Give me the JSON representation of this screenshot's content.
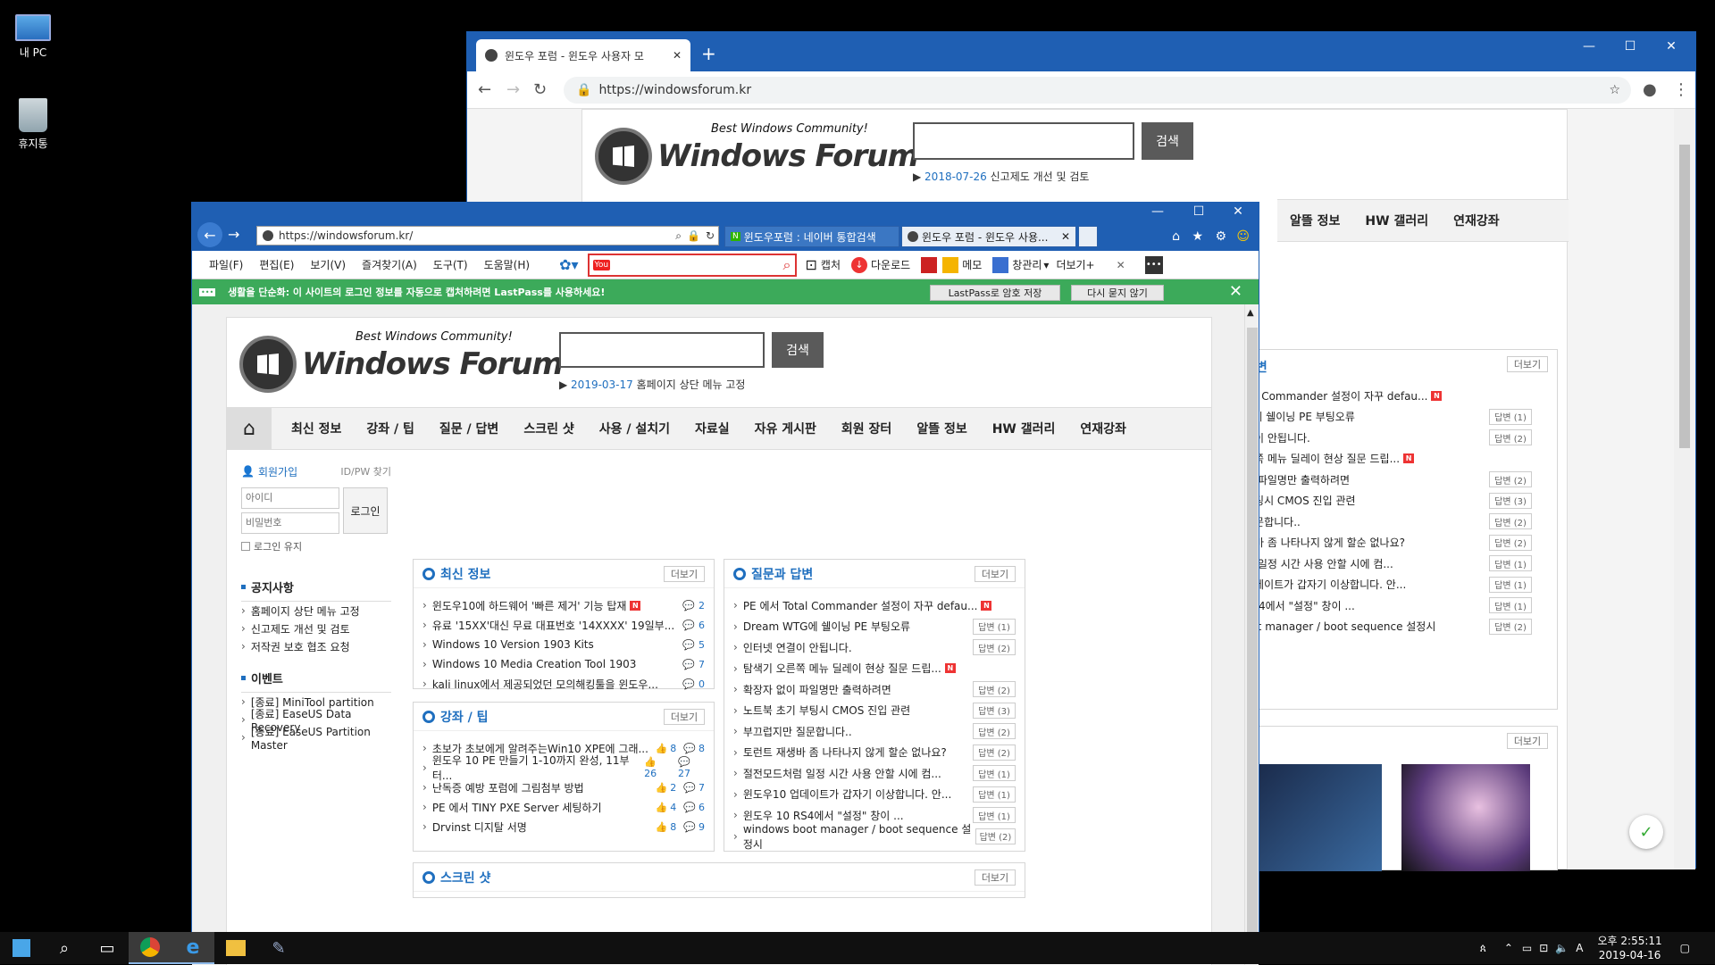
{
  "desktop": {
    "icons": [
      {
        "label": "내 PC"
      },
      {
        "label": "휴지통"
      }
    ]
  },
  "chrome": {
    "tab_title": "윈도우 포럼 - 윈도우 사용자 모",
    "url": "https://windowsforum.kr",
    "site": {
      "tagline": "Best Windows Community!",
      "logo_text": "Windows Forum",
      "search_button": "검색",
      "notice_date": "2018-07-26",
      "notice_text": "신고제도 개선 및 검토"
    },
    "menu_right": [
      "알뜰 정보",
      "HW 갤러리",
      "연재강좌"
    ],
    "qa_title": "답변",
    "more": "더보기",
    "qa_rows": [
      {
        "title": "tal Commander 설정이 자꾸 defau...",
        "answer": ""
      },
      {
        "title": "G에 쉘이닝 PE 부팅오류",
        "answer": "답변 (1)"
      },
      {
        "title": "결이 안됩니다.",
        "answer": "답변 (2)"
      },
      {
        "title": "른쪽 메뉴 딜레이 현상 질문 드립...",
        "answer": ""
      },
      {
        "title": "이 파일명만 출력하려면",
        "answer": "답변 (2)"
      },
      {
        "title": "부팅시 CMOS 진입 관련",
        "answer": "답변 (3)"
      },
      {
        "title": "질문합니다..",
        "answer": "답변 (2)"
      },
      {
        "title": "생바 좀 나타나지 않게 할순 없나요?",
        "answer": "답변 (2)"
      },
      {
        "title": "럼 일정 시간 사용 안할 시에 컴...",
        "answer": "답변 (1)"
      },
      {
        "title": "업데이트가 갑자기 이상합니다. 안...",
        "answer": "답변 (1)"
      },
      {
        "title": "RS4에서 \"설정\" 창이 ...",
        "answer": "답변 (1)"
      },
      {
        "title": "oot manager / boot sequence 설정시",
        "answer": "답변 (2)"
      }
    ],
    "more2": "더보기"
  },
  "ie": {
    "url": "https://windowsforum.kr/",
    "tabs": [
      {
        "label": "윈도우포럼 : 네이버 통합검색"
      },
      {
        "label": "윈도우 포럼 - 윈도우 사용..."
      }
    ],
    "menu": [
      "파일(F)",
      "편집(E)",
      "보기(V)",
      "즐겨찾기(A)",
      "도구(T)",
      "도움말(H)"
    ],
    "toolbar": {
      "capture": "캡처",
      "download": "다운로드",
      "memo": "메모",
      "window_mgr": "창관리",
      "more": "더보기+"
    },
    "lastpass": {
      "message": "생활을 단순화: 이 사이트의 로그인 정보를 자동으로 캡처하려면 LastPass를 사용하세요!",
      "save_btn": "LastPass로 암호 저장",
      "never_btn": "다시 묻지 않기"
    },
    "site": {
      "tagline": "Best Windows Community!",
      "logo_text": "Windows Forum",
      "search_button": "검색",
      "notice_date": "2019-03-17",
      "notice_text": "홈페이지 상단 메뉴 고정",
      "gnb": [
        "최신 정보",
        "강좌 / 팁",
        "질문 / 답변",
        "스크린 샷",
        "사용 / 설치기",
        "자료실",
        "자유 게시판",
        "회원 장터",
        "알뜰 정보",
        "HW 갤러리",
        "연재강좌"
      ],
      "login": {
        "join": "회원가입",
        "find": "ID/PW 찾기",
        "id_placeholder": "아이디",
        "pw_placeholder": "비밀번호",
        "login_btn": "로그인",
        "keep": "로그인 유지"
      },
      "notices_title": "공지사항",
      "notices": [
        "홈페이지 상단 메뉴 고정",
        "신고제도 개선 및 검토",
        "저작권 보호 협조 요청"
      ],
      "events_title": "이벤트",
      "events": [
        "[종료] MiniTool partition",
        "[종료] EaseUS Data Recovery",
        "[종료] EaseUS Partition Master"
      ],
      "more": "더보기",
      "latest": {
        "title": "최신 정보",
        "rows": [
          {
            "title": "윈도우10에 하드웨어 '빠른 제거' 기능 탑재",
            "new": true,
            "comments": "2"
          },
          {
            "title": "유료 '15XX'대신 무료 대표번호 '14XXXX' 19일부...",
            "new": false,
            "comments": "6"
          },
          {
            "title": "Windows 10 Version 1903 Kits",
            "new": false,
            "comments": "5"
          },
          {
            "title": "Windows 10 Media Creation Tool 1903",
            "new": false,
            "comments": "7"
          },
          {
            "title": "kali linux에서 제공되었던 모의해킹툴을 윈도우...",
            "new": false,
            "comments": "0"
          }
        ]
      },
      "tips": {
        "title": "강좌 / 팁",
        "rows": [
          {
            "title": "초보가 초보에게 알려주는Win10 XPE에 그래...",
            "likes": "8",
            "comments": "8"
          },
          {
            "title": "윈도우 10 PE 만들기 1-10까지 완성, 11부터...",
            "likes": "26",
            "comments": "27"
          },
          {
            "title": "난독증 예방 포럼에 그림첨부 방법",
            "likes": "2",
            "comments": "7"
          },
          {
            "title": "PE 에서 TINY PXE Server 세팅하기",
            "likes": "4",
            "comments": "6"
          },
          {
            "title": "Drvinst 디지탈 서명",
            "likes": "8",
            "comments": "9"
          }
        ]
      },
      "qa": {
        "title": "질문과 답변",
        "rows": [
          {
            "title": "PE 에서 Total Commander 설정이 자꾸 defau...",
            "answer": ""
          },
          {
            "title": "Dream WTG에 쉘이닝 PE 부팅오류",
            "answer": "답변 (1)"
          },
          {
            "title": "인터넷 연결이 안됩니다.",
            "answer": "답변 (2)"
          },
          {
            "title": "탐색기 오른쪽 메뉴 딜레이 현상 질문 드립...",
            "answer": ""
          },
          {
            "title": "확장자 없이 파일명만 출력하려면",
            "answer": "답변 (2)"
          },
          {
            "title": "노트북 초기 부팅시 CMOS 진입 관련",
            "answer": "답변 (3)"
          },
          {
            "title": "부끄럽지만 질문합니다..",
            "answer": "답변 (2)"
          },
          {
            "title": "토런트 재생바 좀 나타나지 않게 할순 없나요?",
            "answer": "답변 (2)"
          },
          {
            "title": "절전모드처럼 일정 시간 사용 안할 시에 컴...",
            "answer": "답변 (1)"
          },
          {
            "title": "윈도우10 업데이트가 갑자기 이상합니다. 안...",
            "answer": "답변 (1)"
          },
          {
            "title": "윈도우 10 RS4에서 \"설정\" 창이 ...",
            "answer": "답변 (1)"
          },
          {
            "title": "windows boot manager / boot sequence 설정시",
            "answer": "답변 (2)"
          }
        ]
      },
      "screenshot_title": "스크린 샷"
    }
  },
  "taskbar": {
    "time": "오후 2:55:11",
    "date": "2019-04-16",
    "ime": "A"
  }
}
